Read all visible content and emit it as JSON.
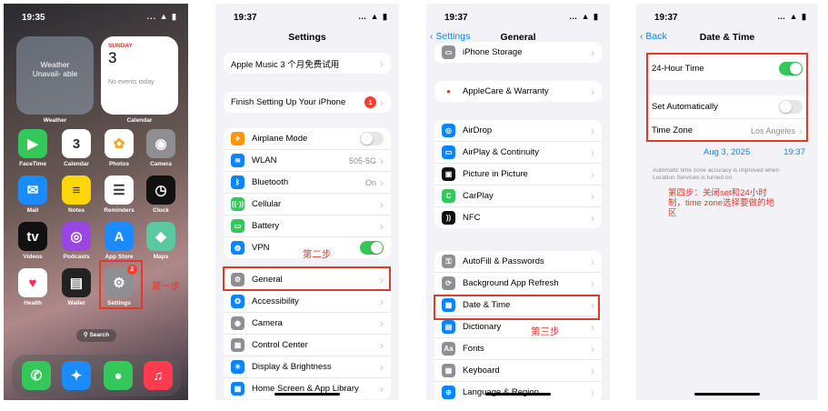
{
  "home": {
    "status_time": "19:35",
    "status_icons": "... ▲ ▮",
    "weather_text": "Weather Unavail- able",
    "weather_label": "Weather",
    "cal_dow": "SUNDAY",
    "cal_day": "3",
    "cal_events": "No events today",
    "cal_label": "Calendar",
    "apps": [
      {
        "label": "FaceTime",
        "glyph": "▶",
        "color": "#34c759"
      },
      {
        "label": "Calendar",
        "glyph": "3",
        "color": "#ffffff",
        "dow": "SUN"
      },
      {
        "label": "Photos",
        "glyph": "✿",
        "color": "#ffffff"
      },
      {
        "label": "Camera",
        "glyph": "◉",
        "color": "#8e8e93"
      },
      {
        "label": "Mail",
        "glyph": "✉",
        "color": "#1a8cff"
      },
      {
        "label": "Notes",
        "glyph": "≡",
        "color": "#ffd60a"
      },
      {
        "label": "Reminders",
        "glyph": "☰",
        "color": "#ffffff"
      },
      {
        "label": "Clock",
        "glyph": "◷",
        "color": "#111111"
      },
      {
        "label": "Videos",
        "glyph": "tv",
        "color": "#111111"
      },
      {
        "label": "Podcasts",
        "glyph": "◎",
        "color": "#9b46e0"
      },
      {
        "label": "App Store",
        "glyph": "A",
        "color": "#1a8cff"
      },
      {
        "label": "Maps",
        "glyph": "◆",
        "color": "#5ac8a0"
      },
      {
        "label": "Health",
        "glyph": "♥",
        "color": "#ffffff"
      },
      {
        "label": "Wallet",
        "glyph": "▤",
        "color": "#222222"
      },
      {
        "label": "Settings",
        "glyph": "⚙",
        "color": "#8e8e93",
        "badge": "2"
      }
    ],
    "search_label": "⚲ Search",
    "dock": [
      {
        "glyph": "✆",
        "color": "#34c759"
      },
      {
        "glyph": "✦",
        "color": "#1a8cff"
      },
      {
        "glyph": "●",
        "color": "#34c759"
      },
      {
        "glyph": "♫",
        "color": "#ff3b50"
      }
    ],
    "step1": "第一步"
  },
  "settings": {
    "status_time": "19:37",
    "title": "Settings",
    "promo": "Apple Music 3 个月免费试用",
    "finish": "Finish Setting Up Your iPhone",
    "finish_badge": "1",
    "rows": [
      {
        "label": "Airplane Mode",
        "color": "#ff9500",
        "glyph": "✈",
        "toggle": "off"
      },
      {
        "label": "WLAN",
        "color": "#0a84ff",
        "glyph": "≋",
        "value": "505-5G"
      },
      {
        "label": "Bluetooth",
        "color": "#0a84ff",
        "glyph": "ᛒ",
        "value": "On"
      },
      {
        "label": "Cellular",
        "color": "#34c759",
        "glyph": "((·))"
      },
      {
        "label": "Battery",
        "color": "#34c759",
        "glyph": "▭"
      },
      {
        "label": "VPN",
        "color": "#0a84ff",
        "glyph": "◍",
        "toggle": "on"
      }
    ],
    "rows2": [
      {
        "label": "General",
        "color": "#8e8e93",
        "glyph": "⚙"
      },
      {
        "label": "Accessibility",
        "color": "#0a84ff",
        "glyph": "✪"
      },
      {
        "label": "Camera",
        "color": "#8e8e93",
        "glyph": "◉"
      },
      {
        "label": "Control Center",
        "color": "#8e8e93",
        "glyph": "▦"
      },
      {
        "label": "Display & Brightness",
        "color": "#0a84ff",
        "glyph": "☀"
      },
      {
        "label": "Home Screen & App Library",
        "color": "#0a84ff",
        "glyph": "▦"
      }
    ],
    "step2": "第二步"
  },
  "general": {
    "status_time": "19:37",
    "back": "Settings",
    "title": "General",
    "rows_a": [
      {
        "label": "iPhone Storage",
        "color": "#8e8e93",
        "glyph": "▭"
      }
    ],
    "rows_b": [
      {
        "label": "AppleCare & Warranty",
        "color": "#ffffff",
        "glyph": "●"
      }
    ],
    "rows_c": [
      {
        "label": "AirDrop",
        "color": "#0a84ff",
        "glyph": "◎"
      },
      {
        "label": "AirPlay & Continuity",
        "color": "#0a84ff",
        "glyph": "▭"
      },
      {
        "label": "Picture in Picture",
        "color": "#111111",
        "glyph": "▣"
      },
      {
        "label": "CarPlay",
        "color": "#34c759",
        "glyph": "C"
      },
      {
        "label": "NFC",
        "color": "#111111",
        "glyph": "))"
      }
    ],
    "rows_d": [
      {
        "label": "AutoFill & Passwords",
        "color": "#8e8e93",
        "glyph": "⚿"
      },
      {
        "label": "Background App Refresh",
        "color": "#8e8e93",
        "glyph": "⟳"
      },
      {
        "label": "Date & Time",
        "color": "#0a84ff",
        "glyph": "▦"
      },
      {
        "label": "Dictionary",
        "color": "#0a84ff",
        "glyph": "▤"
      },
      {
        "label": "Fonts",
        "color": "#8e8e93",
        "glyph": "Aa"
      },
      {
        "label": "Keyboard",
        "color": "#8e8e93",
        "glyph": "▦"
      },
      {
        "label": "Language & Region",
        "color": "#0a84ff",
        "glyph": "⊕"
      }
    ],
    "step3": "第三步"
  },
  "datetime": {
    "status_time": "19:37",
    "back": "Back",
    "title": "Date & Time",
    "hour24": "24-Hour Time",
    "set_auto": "Set Automatically",
    "timezone": "Time Zone",
    "timezone_value": "Los Angeles",
    "date": "Aug 3, 2025",
    "time": "19:37",
    "note": "Automatic time zone accuracy is improved when Location Services is turned on.",
    "step4": "第四步：关闭set和24小时制，time zone选择要做的地区"
  }
}
